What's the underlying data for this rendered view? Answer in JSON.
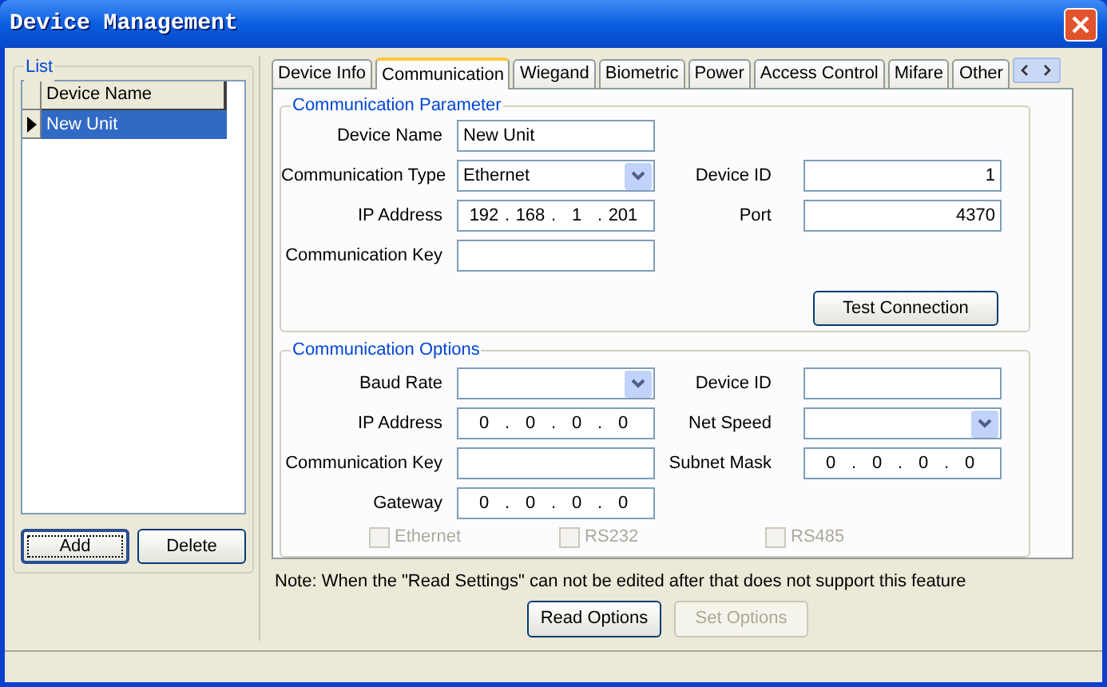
{
  "window": {
    "title": "Device Management"
  },
  "list": {
    "title": "List",
    "column": "Device Name",
    "rows": [
      {
        "name": "New Unit",
        "selected": true
      }
    ],
    "buttons": [
      {
        "label": "Add",
        "focused": true
      },
      {
        "label": "Delete",
        "focused": false
      }
    ]
  },
  "tabs": [
    {
      "label": "Device Info",
      "selected": false
    },
    {
      "label": "Communication",
      "selected": true
    },
    {
      "label": "Wiegand",
      "selected": false
    },
    {
      "label": "Biometric",
      "selected": false
    },
    {
      "label": "Power",
      "selected": false
    },
    {
      "label": "Access Control",
      "selected": false
    },
    {
      "label": "Mifare",
      "selected": false
    },
    {
      "label": "Other",
      "selected": false
    }
  ],
  "communication_parameter": {
    "title": "Communication Parameter",
    "rows": [
      {
        "left": {
          "label": "Device Name",
          "kind": "text",
          "value": "New Unit"
        }
      },
      {
        "left": {
          "label": "Communication Type",
          "kind": "dropdown",
          "value": "Ethernet"
        },
        "right": {
          "label": "Device ID",
          "kind": "number",
          "value": "1"
        }
      },
      {
        "left": {
          "label": "IP Address",
          "kind": "ip",
          "value": "192 . 168 . 1 . 201"
        },
        "right": {
          "label": "Port",
          "kind": "number",
          "value": "4370"
        }
      },
      {
        "left": {
          "label": "Communication Key",
          "kind": "text"
        }
      }
    ],
    "button": "Test Connection"
  },
  "communication_options": {
    "title": "Communication Options",
    "rows": [
      {
        "left": {
          "label": "Baud Rate",
          "kind": "dropdown"
        },
        "right": {
          "label": "Device ID",
          "kind": "text"
        }
      },
      {
        "left": {
          "label": "IP Address",
          "kind": "ip",
          "value": "0 . 0 . 0 . 0"
        },
        "right": {
          "label": "Net Speed",
          "kind": "dropdown"
        }
      },
      {
        "left": {
          "label": "Communication Key",
          "kind": "text"
        },
        "right": {
          "label": "Subnet Mask",
          "kind": "ip",
          "value": "0 . 0 . 0 . 0"
        }
      },
      {
        "left": {
          "label": "Gateway",
          "kind": "ip",
          "value": "0 . 0 . 0 . 0"
        }
      }
    ],
    "checkboxes": [
      {
        "label": "Ethernet",
        "checked": false,
        "disabled": true
      },
      {
        "label": "RS232",
        "checked": false,
        "disabled": true
      },
      {
        "label": "RS485",
        "checked": false,
        "disabled": true
      }
    ]
  },
  "note": "Note: When the \"Read Settings\" can not be edited after that does not support this feature",
  "buttons": [
    {
      "label": "Read Options",
      "disabled": false
    },
    {
      "label": "Set Options",
      "disabled": true
    }
  ]
}
